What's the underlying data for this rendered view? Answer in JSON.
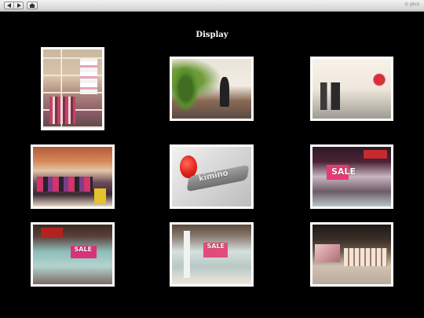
{
  "toolbar": {
    "back_icon": "left-arrow-icon",
    "forward_icon": "right-arrow-icon",
    "home_icon": "home-icon",
    "right_text": "⊙ pics"
  },
  "page": {
    "title": "Display"
  },
  "gallery": {
    "thumbnails": [
      {
        "photo_text": ""
      },
      {
        "photo_text": ""
      },
      {
        "photo_text": ""
      },
      {
        "photo_text": ""
      },
      {
        "photo_text": "kimino"
      },
      {
        "photo_text": "SALE"
      },
      {
        "photo_text": "SALE"
      },
      {
        "photo_text": "SALE"
      },
      {
        "photo_text": ""
      }
    ]
  },
  "colors": {
    "background": "#000000",
    "thumbnail_border": "#ffffff",
    "title_text": "#ffffff"
  }
}
